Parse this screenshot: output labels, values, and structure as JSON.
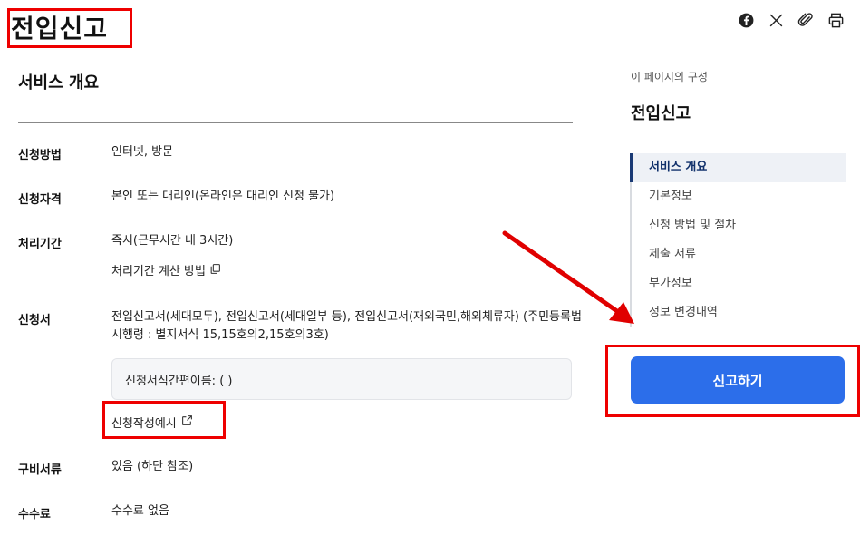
{
  "header": {
    "title": "전입신고",
    "icons": [
      "facebook-icon",
      "x-icon",
      "attachment-icon",
      "print-icon"
    ]
  },
  "service": {
    "heading": "서비스 개요",
    "rows": [
      {
        "label": "신청방법",
        "value": "인터넷, 방문"
      },
      {
        "label": "신청자격",
        "value": "본인 또는 대리인(온라인은 대리인 신청 불가)"
      },
      {
        "label": "처리기간",
        "value": "즉시(근무시간 내 3시간)",
        "link": "처리기간 계산 방법"
      },
      {
        "label": "신청서",
        "value_line1": "전입신고서(세대모두), 전입신고서(세대일부 등), 전입신고서(재외국민,해외체류자) (주민등록법",
        "value_line2": "시행령 : 별지서식 15,15호의2,15호의3호)",
        "note": "신청서식간편이름: ( )",
        "example_link": "신청작성예시"
      },
      {
        "label": "구비서류",
        "value": "있음 (하단 참조)"
      },
      {
        "label": "수수료",
        "value": "수수료 없음"
      }
    ]
  },
  "toc": {
    "caption": "이 페이지의 구성",
    "title": "전입신고",
    "items": [
      "서비스 개요",
      "기본정보",
      "신청 방법 및 절차",
      "제출 서류",
      "부가정보",
      "정보 변경내역"
    ],
    "active_index": 0
  },
  "action": {
    "report_label": "신고하기"
  },
  "colors": {
    "accent": "#2c6eea",
    "annotation": "#e00000",
    "toc_active": "#1a3a75"
  }
}
